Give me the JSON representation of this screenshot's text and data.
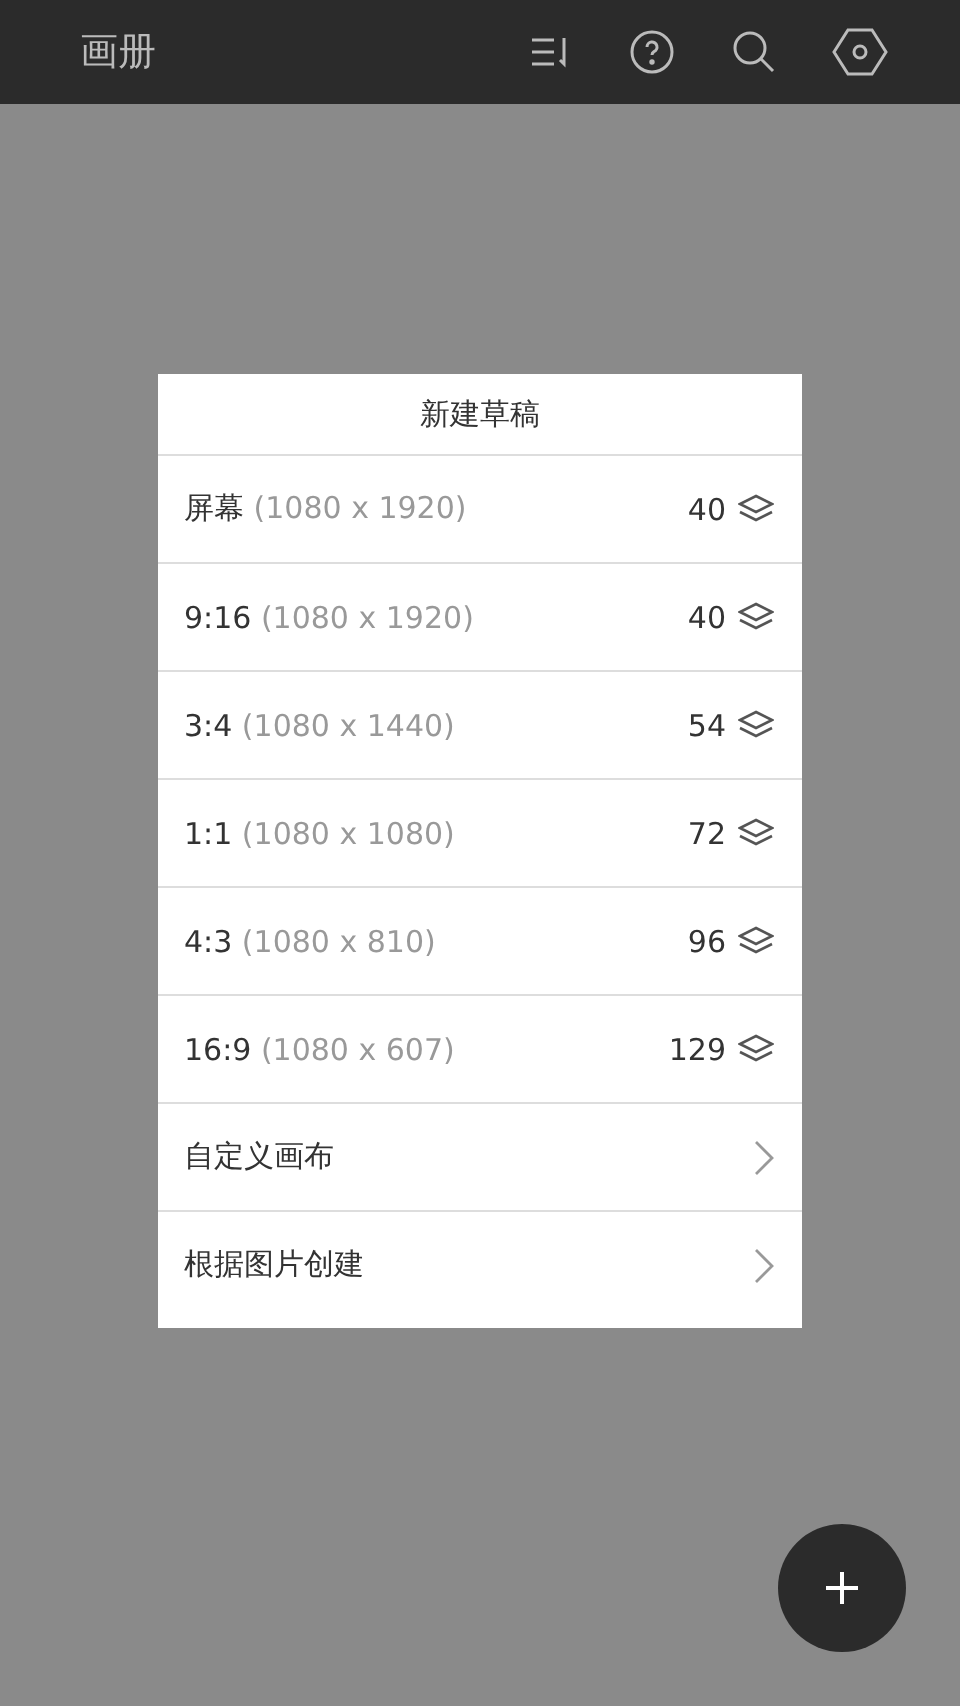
{
  "app_bar": {
    "title": "画册"
  },
  "dialog": {
    "title": "新建草稿",
    "items": [
      {
        "kind": "size",
        "name": "屏幕",
        "dims": "(1080 x 1920)",
        "count": "40"
      },
      {
        "kind": "size",
        "name": "9:16",
        "dims": "(1080 x 1920)",
        "count": "40"
      },
      {
        "kind": "size",
        "name": "3:4",
        "dims": "(1080 x 1440)",
        "count": "54"
      },
      {
        "kind": "size",
        "name": "1:1",
        "dims": "(1080 x 1080)",
        "count": "72"
      },
      {
        "kind": "size",
        "name": "4:3",
        "dims": "(1080 x 810)",
        "count": "96"
      },
      {
        "kind": "size",
        "name": "16:9",
        "dims": "(1080 x 607)",
        "count": "129"
      },
      {
        "kind": "link",
        "name": "自定义画布"
      },
      {
        "kind": "link",
        "name": "根据图片创建"
      }
    ]
  }
}
